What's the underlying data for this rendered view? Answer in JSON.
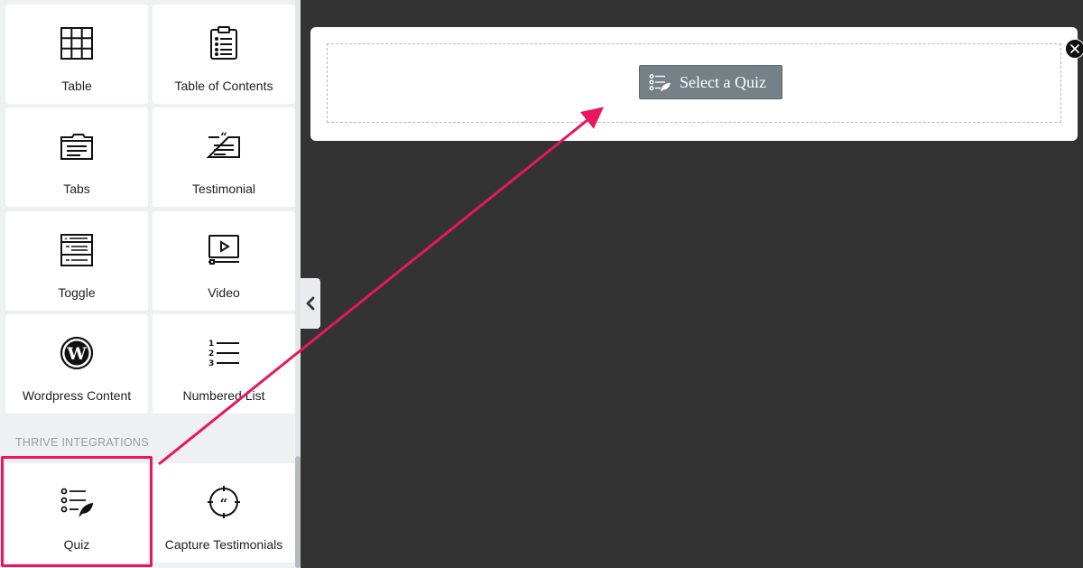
{
  "sidebar": {
    "tiles": [
      {
        "label": "Table",
        "icon": "table-icon"
      },
      {
        "label": "Table of Contents",
        "icon": "table-of-contents-icon"
      },
      {
        "label": "Tabs",
        "icon": "tabs-icon"
      },
      {
        "label": "Testimonial",
        "icon": "testimonial-icon"
      },
      {
        "label": "Toggle",
        "icon": "toggle-icon"
      },
      {
        "label": "Video",
        "icon": "video-icon"
      },
      {
        "label": "Wordpress Content",
        "icon": "wordpress-icon"
      },
      {
        "label": "Numbered List",
        "icon": "numbered-list-icon"
      }
    ],
    "section_title": "THRIVE INTEGRATIONS",
    "integrations": [
      {
        "label": "Quiz",
        "icon": "quiz-icon"
      },
      {
        "label": "Capture Testimonials",
        "icon": "capture-testimonials-icon"
      }
    ]
  },
  "canvas": {
    "select_quiz_label": "Select a Quiz"
  },
  "colors": {
    "highlight": "#e8175d",
    "canvas_background": "#333333",
    "sidebar_background": "#eef0f1",
    "button_background": "#768087"
  }
}
